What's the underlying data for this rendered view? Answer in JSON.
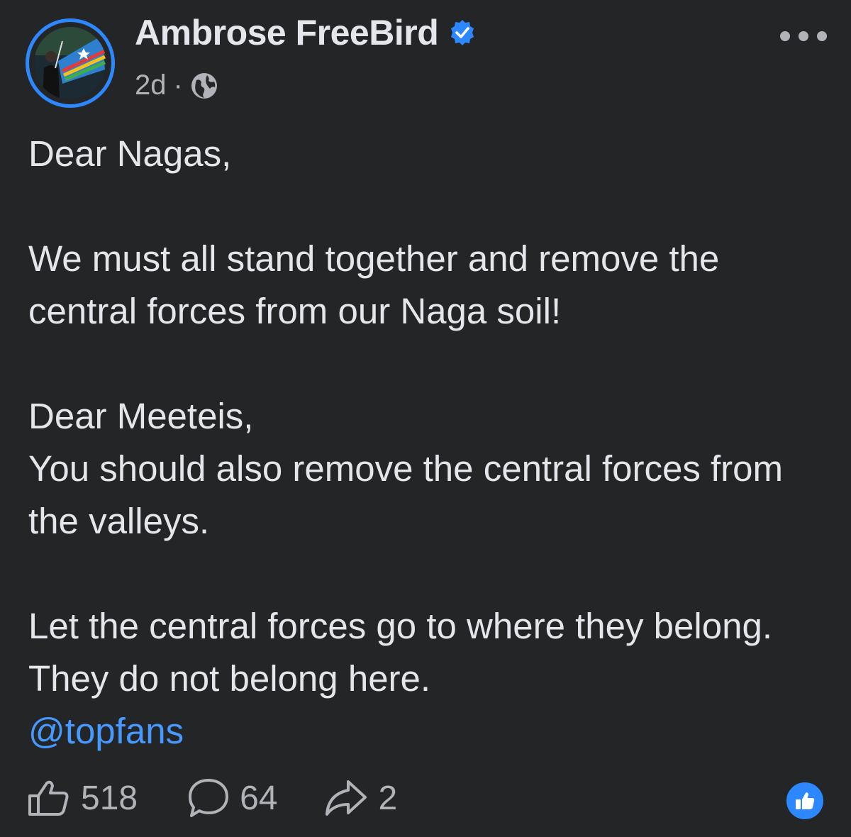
{
  "post": {
    "author": {
      "name": "Ambrose FreeBird",
      "verified_icon": "verified-badge-icon",
      "avatar": "profile-photo"
    },
    "meta": {
      "time": "2d",
      "separator": "·",
      "audience_icon": "globe-icon"
    },
    "menu_icon": "more-options-icon",
    "body": {
      "greeting_nagas": "Dear Nagas,",
      "message_nagas": "We must all stand together and remove the central forces from our Naga soil!",
      "greeting_meeteis": "Dear Meeteis,",
      "message_meeteis": "You should also remove the central forces from the valleys.",
      "closing": "Let the central forces go to where they belong. They do not belong here.",
      "mention": "@topfans"
    },
    "actions": {
      "likes": "518",
      "comments": "64",
      "shares": "2",
      "reaction_icon": "like-reaction-icon"
    }
  },
  "colors": {
    "background": "#242526",
    "text": "#e4e6eb",
    "secondary_text": "#b0b3b8",
    "accent": "#2d88ff",
    "mention": "#4599ff"
  }
}
